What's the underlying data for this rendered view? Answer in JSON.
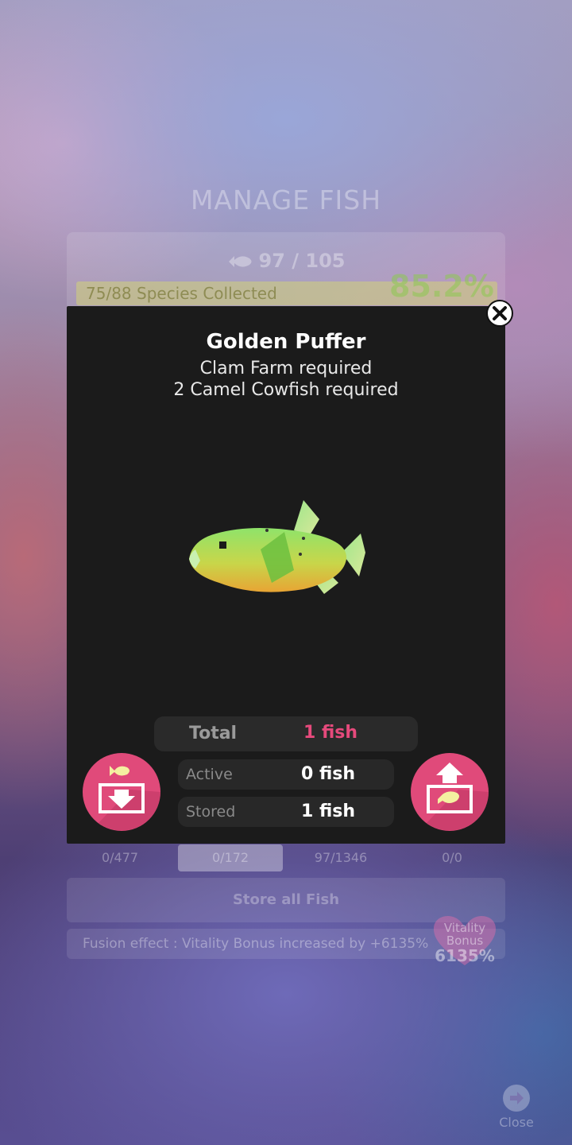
{
  "background": {
    "title": "MANAGE FISH",
    "fish_count": "97 / 105",
    "species_progress_label": "75/88 Species Collected",
    "species_percent": "85.2%",
    "tabs": [
      {
        "value": "0/477"
      },
      {
        "value": "0/172"
      },
      {
        "value": "97/1346"
      },
      {
        "value": "0/0"
      }
    ],
    "store_all_label": "Store all Fish",
    "fusion_text": "Fusion effect : Vitality Bonus increased by +6135%",
    "vitality": {
      "line1": "Vitality",
      "line2": "Bonus",
      "value": "6135%"
    },
    "close_label": "Close"
  },
  "modal": {
    "fish_name": "Golden Puffer",
    "requirement_1": "Clam Farm required",
    "requirement_2": "2 Camel Cowfish required",
    "total_label": "Total",
    "total_value": "1 fish",
    "active_label": "Active",
    "active_value": "0 fish",
    "stored_label": "Stored",
    "stored_value": "1 fish",
    "accent_color": "#e04a7a",
    "icons": [
      "store-fish-icon",
      "retrieve-fish-icon",
      "close-icon"
    ]
  }
}
